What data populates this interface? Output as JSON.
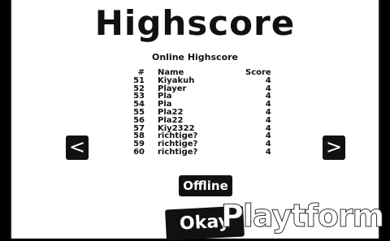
{
  "title": "Highscore",
  "subtitle": "Online Highscore",
  "table": {
    "headers": {
      "rank": "#",
      "name": "Name",
      "score": "Score"
    },
    "rows": [
      {
        "rank": "51",
        "name": "Kiyakuh",
        "score": "4"
      },
      {
        "rank": "52",
        "name": "Player",
        "score": "4"
      },
      {
        "rank": "53",
        "name": "Pla",
        "score": "4"
      },
      {
        "rank": "54",
        "name": "Pla",
        "score": "4"
      },
      {
        "rank": "55",
        "name": "Pla22",
        "score": "4"
      },
      {
        "rank": "56",
        "name": "Pla22",
        "score": "4"
      },
      {
        "rank": "57",
        "name": "Kiy2322",
        "score": "4"
      },
      {
        "rank": "58",
        "name": "richtige?",
        "score": "4"
      },
      {
        "rank": "59",
        "name": "richtige?",
        "score": "4"
      },
      {
        "rank": "60",
        "name": "richtige?",
        "score": "4"
      }
    ]
  },
  "nav": {
    "prev_label": "<",
    "next_label": ">"
  },
  "buttons": {
    "offline_label": "Offline",
    "okay_label": "Okay"
  },
  "watermark": {
    "text": "Playtform",
    "url": "www.playtform.net"
  },
  "colors": {
    "background": "#ffffff",
    "ink": "#111111",
    "button_text": "#ffffff"
  }
}
